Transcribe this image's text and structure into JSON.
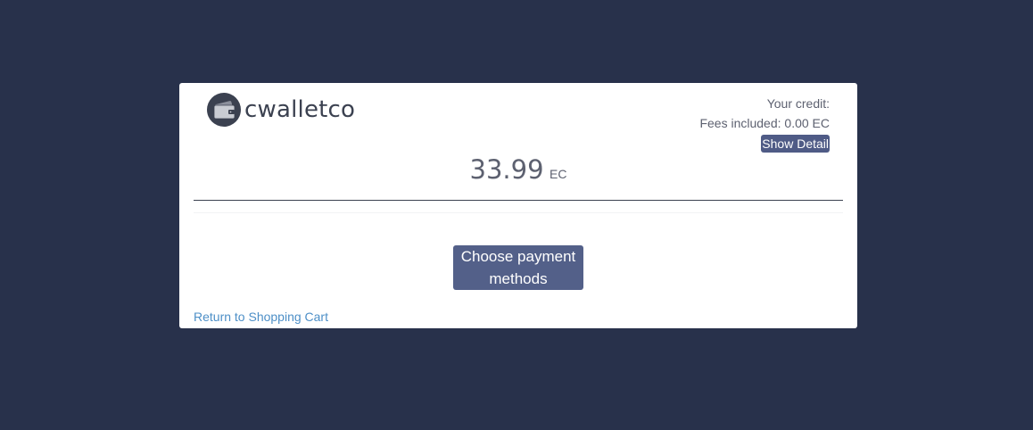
{
  "brand": {
    "name": "cwalletco",
    "icon": "wallet-icon"
  },
  "credit": {
    "label": "Your credit:",
    "fees": "Fees included: 0.00 EC",
    "show_detail_label": "Show Detail"
  },
  "amount": {
    "value": "33.99",
    "currency": "EC"
  },
  "actions": {
    "choose_payment_label": "Choose payment methods",
    "return_label": "Return to Shopping Cart"
  },
  "colors": {
    "background": "#28314b",
    "card": "#ffffff",
    "button": "#536089",
    "link": "#4d8fc7",
    "text": "#5d6170"
  }
}
